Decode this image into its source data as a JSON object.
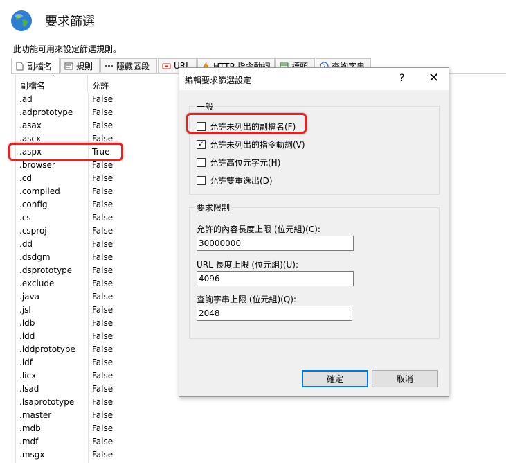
{
  "header": {
    "title": "要求篩選",
    "description": "此功能可用來設定篩選規則。"
  },
  "tabs": [
    {
      "label": "副檔名",
      "icon": "document-icon"
    },
    {
      "label": "規則",
      "icon": "rules-icon"
    },
    {
      "label": "隱藏區段",
      "icon": "hidden-segments-icon"
    },
    {
      "label": "URL",
      "icon": "url-icon"
    },
    {
      "label": "HTTP 指令動詞",
      "icon": "http-verb-icon"
    },
    {
      "label": "標頭",
      "icon": "headers-icon"
    },
    {
      "label": "查詢字串",
      "icon": "help-icon"
    }
  ],
  "list": {
    "columns": [
      "副檔名",
      "允許"
    ],
    "rows": [
      {
        "name": ".ad",
        "allowed": "False"
      },
      {
        "name": ".adprototype",
        "allowed": "False"
      },
      {
        "name": ".asax",
        "allowed": "False"
      },
      {
        "name": ".ascx",
        "allowed": "False"
      },
      {
        "name": ".aspx",
        "allowed": "True"
      },
      {
        "name": ".browser",
        "allowed": "False"
      },
      {
        "name": ".cd",
        "allowed": "False"
      },
      {
        "name": ".compiled",
        "allowed": "False"
      },
      {
        "name": ".config",
        "allowed": "False"
      },
      {
        "name": ".cs",
        "allowed": "False"
      },
      {
        "name": ".csproj",
        "allowed": "False"
      },
      {
        "name": ".dd",
        "allowed": "False"
      },
      {
        "name": ".dsdgm",
        "allowed": "False"
      },
      {
        "name": ".dsprototype",
        "allowed": "False"
      },
      {
        "name": ".exclude",
        "allowed": "False"
      },
      {
        "name": ".java",
        "allowed": "False"
      },
      {
        "name": ".jsl",
        "allowed": "False"
      },
      {
        "name": ".ldb",
        "allowed": "False"
      },
      {
        "name": ".ldd",
        "allowed": "False"
      },
      {
        "name": ".lddprototype",
        "allowed": "False"
      },
      {
        "name": ".ldf",
        "allowed": "False"
      },
      {
        "name": ".licx",
        "allowed": "False"
      },
      {
        "name": ".lsad",
        "allowed": "False"
      },
      {
        "name": ".lsaprototype",
        "allowed": "False"
      },
      {
        "name": ".master",
        "allowed": "False"
      },
      {
        "name": ".mdb",
        "allowed": "False"
      },
      {
        "name": ".mdf",
        "allowed": "False"
      },
      {
        "name": ".msgx",
        "allowed": "False"
      }
    ]
  },
  "dialog": {
    "title": "編輯要求篩選設定",
    "help": "?",
    "close": "✕",
    "general": {
      "label": "一般",
      "options": [
        {
          "label": "允許未列出的副檔名(F)",
          "checked": false
        },
        {
          "label": "允許未列出的指令動詞(V)",
          "checked": true
        },
        {
          "label": "允許高位元字元(H)",
          "checked": false
        },
        {
          "label": "允許雙重逸出(D)",
          "checked": false
        }
      ]
    },
    "limits": {
      "label": "要求限制",
      "content_length_label": "允許的內容長度上限 (位元組)(C):",
      "content_length_value": "30000000",
      "url_length_label": "URL 長度上限 (位元組)(U):",
      "url_length_value": "4096",
      "query_length_label": "查詢字串上限 (位元組)(Q):",
      "query_length_value": "2048"
    },
    "ok_label": "確定",
    "cancel_label": "取消"
  },
  "colors": {
    "highlight": "#d02a2a",
    "primary_border": "#0078d7"
  }
}
